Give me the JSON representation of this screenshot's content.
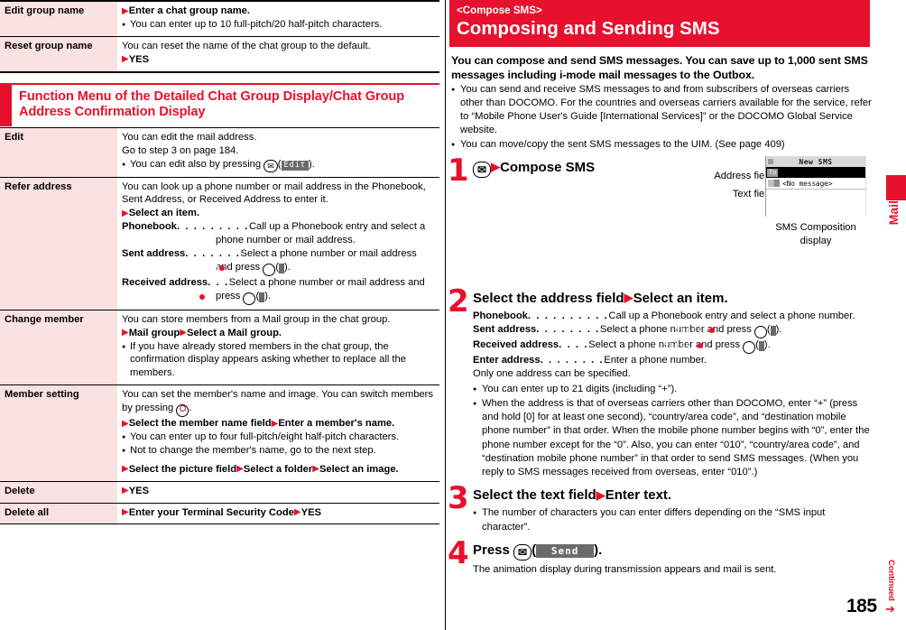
{
  "left_table": {
    "rows": [
      {
        "key": "Edit group name",
        "lines": [
          {
            "type": "arrow-bold",
            "text": "Enter a chat group name."
          },
          {
            "type": "bullet",
            "text": "You can enter up to 10 full-pitch/20 half-pitch characters."
          }
        ]
      },
      {
        "key": "Reset group name",
        "lines": [
          {
            "type": "plain",
            "text": "You can reset the name of the chat group to the default."
          },
          {
            "type": "arrow-bold",
            "text": "YES"
          }
        ]
      }
    ]
  },
  "section_header": {
    "title": "Function Menu of the Detailed Chat Group Display/Chat Group Address Confirmation Display"
  },
  "left_table2": {
    "rows": [
      {
        "key": "Edit",
        "lines": [
          {
            "type": "plain",
            "text": "You can edit the mail address."
          },
          {
            "type": "plain",
            "text": "Go to step 3 on page 184."
          },
          {
            "type": "bullet-key",
            "text_before": "You can edit also by pressing ",
            "key_icon": "mail-key-icon",
            "softkey": "Edit",
            "text_after": "."
          }
        ]
      },
      {
        "key": "Refer address",
        "lines": [
          {
            "type": "plain",
            "text": "You can look up a phone number or mail address in the Phonebook, Sent Address, or Received Address to enter it."
          },
          {
            "type": "arrow-bold",
            "text": "Select an item."
          },
          {
            "type": "hang",
            "label": "Phonebook",
            "dots": ". . . . . . . . .",
            "text": "Call up a Phonebook entry and select a phone number or mail address."
          },
          {
            "type": "hang",
            "label": "Sent address",
            "dots": ". . . . . . .",
            "text": "Select a phone number or mail address and press",
            "key_icon": "center-key-icon",
            "softkey": "Select",
            "text_after": "."
          },
          {
            "type": "hang",
            "label": "Received address",
            "dots": ". . .",
            "text": "Select a phone number or mail address and press",
            "key_icon": "center-key-icon",
            "softkey": "Select",
            "text_after": "."
          }
        ]
      },
      {
        "key": "Change member",
        "lines": [
          {
            "type": "plain",
            "text": "You can store members from a Mail group in the chat group."
          },
          {
            "type": "arrow-bold2",
            "text1": "Mail group",
            "text2": "Select a Mail group."
          },
          {
            "type": "bullet",
            "text": "If you have already stored members in the chat group, the confirmation display appears asking whether to replace all the members."
          }
        ]
      },
      {
        "key": "Member setting",
        "lines": [
          {
            "type": "plain-key",
            "text_before": "You can set the member's name and image. You can switch members by pressing ",
            "key_icon": "multi-cursor-key-icon",
            "text_after": "."
          },
          {
            "type": "arrow-bold2",
            "text1": "Select the member name field",
            "text2": "Enter a member's name."
          },
          {
            "type": "bullet",
            "text": "You can enter up to four full-pitch/eight half-pitch characters."
          },
          {
            "type": "bullet",
            "text": "Not to change the member's name, go to the next step."
          },
          {
            "type": "arrow-bold3",
            "text1": "Select the picture field",
            "text2": "Select a folder",
            "text3": "Select an image."
          }
        ]
      },
      {
        "key": "Delete",
        "lines": [
          {
            "type": "arrow-bold",
            "text": "YES"
          }
        ]
      },
      {
        "key": "Delete all",
        "lines": [
          {
            "type": "arrow-bold2",
            "text1": "Enter your Terminal Security Code",
            "text2": "YES"
          }
        ]
      }
    ]
  },
  "right": {
    "banner": {
      "kicker": "<Compose SMS>",
      "title": "Composing and Sending SMS"
    },
    "lead": "You can compose and send SMS messages. You can save up to 1,000 sent SMS messages including i-mode mail messages to the Outbox.",
    "intro_bullets": [
      "You can send and receive SMS messages to and from subscribers of overseas carriers other than DOCOMO. For the countries and overseas carriers available for the service, refer to “Mobile Phone User's Guide [International Services]” or the DOCOMO Global Service website.",
      "You can move/copy the sent SMS messages to the UIM. (See page 409)"
    ],
    "steps": [
      {
        "num": "1",
        "title_key_icon": "mail-key-icon",
        "title": "Compose SMS"
      },
      {
        "num": "2",
        "title1": "Select the address field",
        "title2": "Select an item.",
        "options": [
          {
            "label": "Phonebook",
            "dots": ". . . . . . . . . .",
            "text": "Call up a Phonebook entry and select a phone number."
          },
          {
            "label": "Sent address",
            "dots": ". . . . . . . .",
            "text": "Select a phone number and press",
            "key_icon": "center-key-icon",
            "softkey": "Select",
            "text_after": "."
          },
          {
            "label": "Received address",
            "dots": ". . . .",
            "text": "Select a phone number and press",
            "key_icon": "center-key-icon",
            "softkey": "Select",
            "text_after": "."
          },
          {
            "label": "Enter address",
            "dots": ". . . . . . . .",
            "text": "Enter a phone number."
          }
        ],
        "note": "Only one address can be specified.",
        "bullets": [
          "You can enter up to 21 digits (including “+”).",
          "When the address is that of overseas carriers other than DOCOMO, enter “+” (press and hold [0] for at least one second), “country/area code”, and “destination mobile phone number” in that order. When the mobile phone number begins with “0”, enter the phone number except for the “0”. Also, you can enter “010”, “country/area code”, and “destination mobile phone number” in that order to send SMS messages. (When you reply to SMS messages received from overseas, enter “010”.)"
        ]
      },
      {
        "num": "3",
        "title1": "Select the text field",
        "title2": "Enter text.",
        "bullets": [
          "The number of characters you can enter differs depending on the “SMS input character”."
        ]
      },
      {
        "num": "4",
        "title_prefix": "Press",
        "title_key_icon": "mail-key-icon",
        "softkey": "Send",
        "title_suffix": ").",
        "sub": "The animation display during transmission appears and mail is sent."
      }
    ],
    "figure": {
      "callout_address": "Address field",
      "callout_text": "Text field",
      "caption": "SMS Composition display",
      "screen": {
        "title": "New SMS",
        "addr_tag": "To",
        "text_value": "<No message>"
      }
    }
  },
  "footer": {
    "page_number": "185",
    "continued": "Continued",
    "side_tab_label": "Mail"
  },
  "colors": {
    "accent_red": "#e8112d",
    "key_cell_bg": "#fbe2e2",
    "softkey_bg": "#6b6b6b"
  }
}
